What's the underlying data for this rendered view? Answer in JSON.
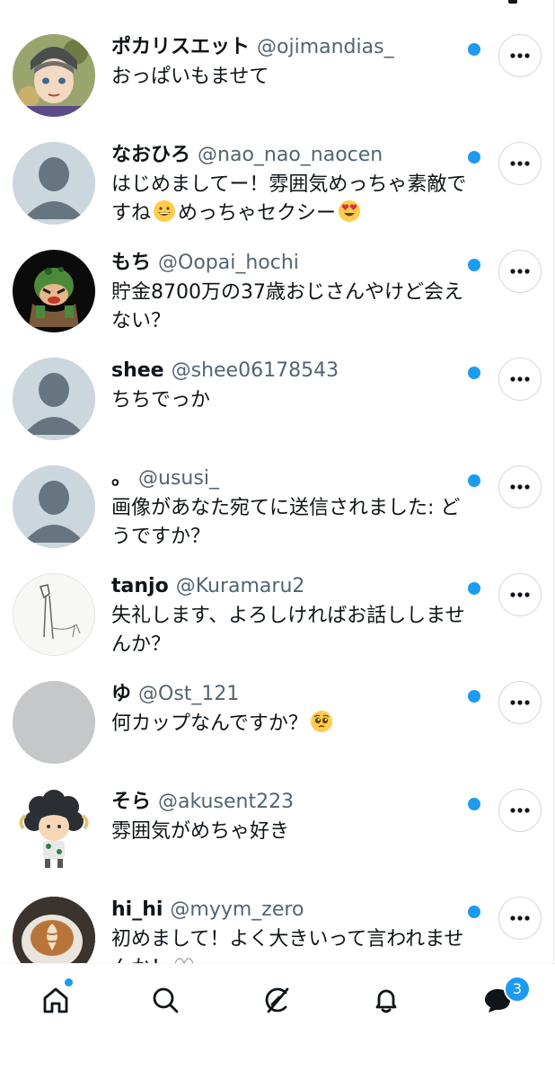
{
  "messages": [
    {
      "name": "ポカリスエット",
      "handle": "@ojimandias_",
      "text": "おっぱいもませて",
      "avatar": "illustrated-character-avatar",
      "unread": true
    },
    {
      "name": "なおひろ",
      "handle": "@nao_nao_naocen",
      "text_a": "はじめましてー！雰囲気めっちゃ素敵ですね",
      "text_b": "めっちゃセクシー",
      "avatar": "default-avatar",
      "emojis": [
        "grinning-face-emoji",
        "heart-eyes-emoji"
      ],
      "unread": true
    },
    {
      "name": "もち",
      "handle": "@Oopai_hochi",
      "text": "貯金8700万の37歳おじさんやけど会えない？",
      "avatar": "cartoon-avatar",
      "unread": true
    },
    {
      "name": "shee",
      "handle": "@shee06178543",
      "text": "ちちでっか",
      "avatar": "default-avatar",
      "unread": true
    },
    {
      "name": "。",
      "handle": "@ususi_",
      "text": "画像があなた宛てに送信されました: どうですか？",
      "avatar": "default-avatar",
      "unread": true
    },
    {
      "name": "tanjo",
      "handle": "@Kuramaru2",
      "text": "失礼します、よろしければお話ししませんか？",
      "avatar": "sketch-avatar",
      "unread": true
    },
    {
      "name": "ゆ",
      "handle": "@Ost_121",
      "text": "何カップなんですか？",
      "avatar": "gray-avatar",
      "emojis": [
        "pleading-face-emoji"
      ],
      "unread": true
    },
    {
      "name": "そら",
      "handle": "@akusent223",
      "text": "雰囲気がめちゃ好き",
      "avatar": "sheep-character-avatar",
      "unread": true
    },
    {
      "name": "hi_hi",
      "handle": "@myym_zero",
      "text": "初めまして！よく大きいって言われませんか！",
      "avatar": "latte-photo-avatar",
      "emojis": [
        "eyes-emoji"
      ],
      "unread": true
    }
  ],
  "bottom_nav": {
    "items": [
      "home-icon",
      "search-icon",
      "grok-icon",
      "notifications-icon",
      "messages-icon"
    ],
    "messages_badge": "3"
  },
  "colors": {
    "accent": "#1d9bf0",
    "secondary_text": "#536471",
    "border": "#cfd9de"
  }
}
